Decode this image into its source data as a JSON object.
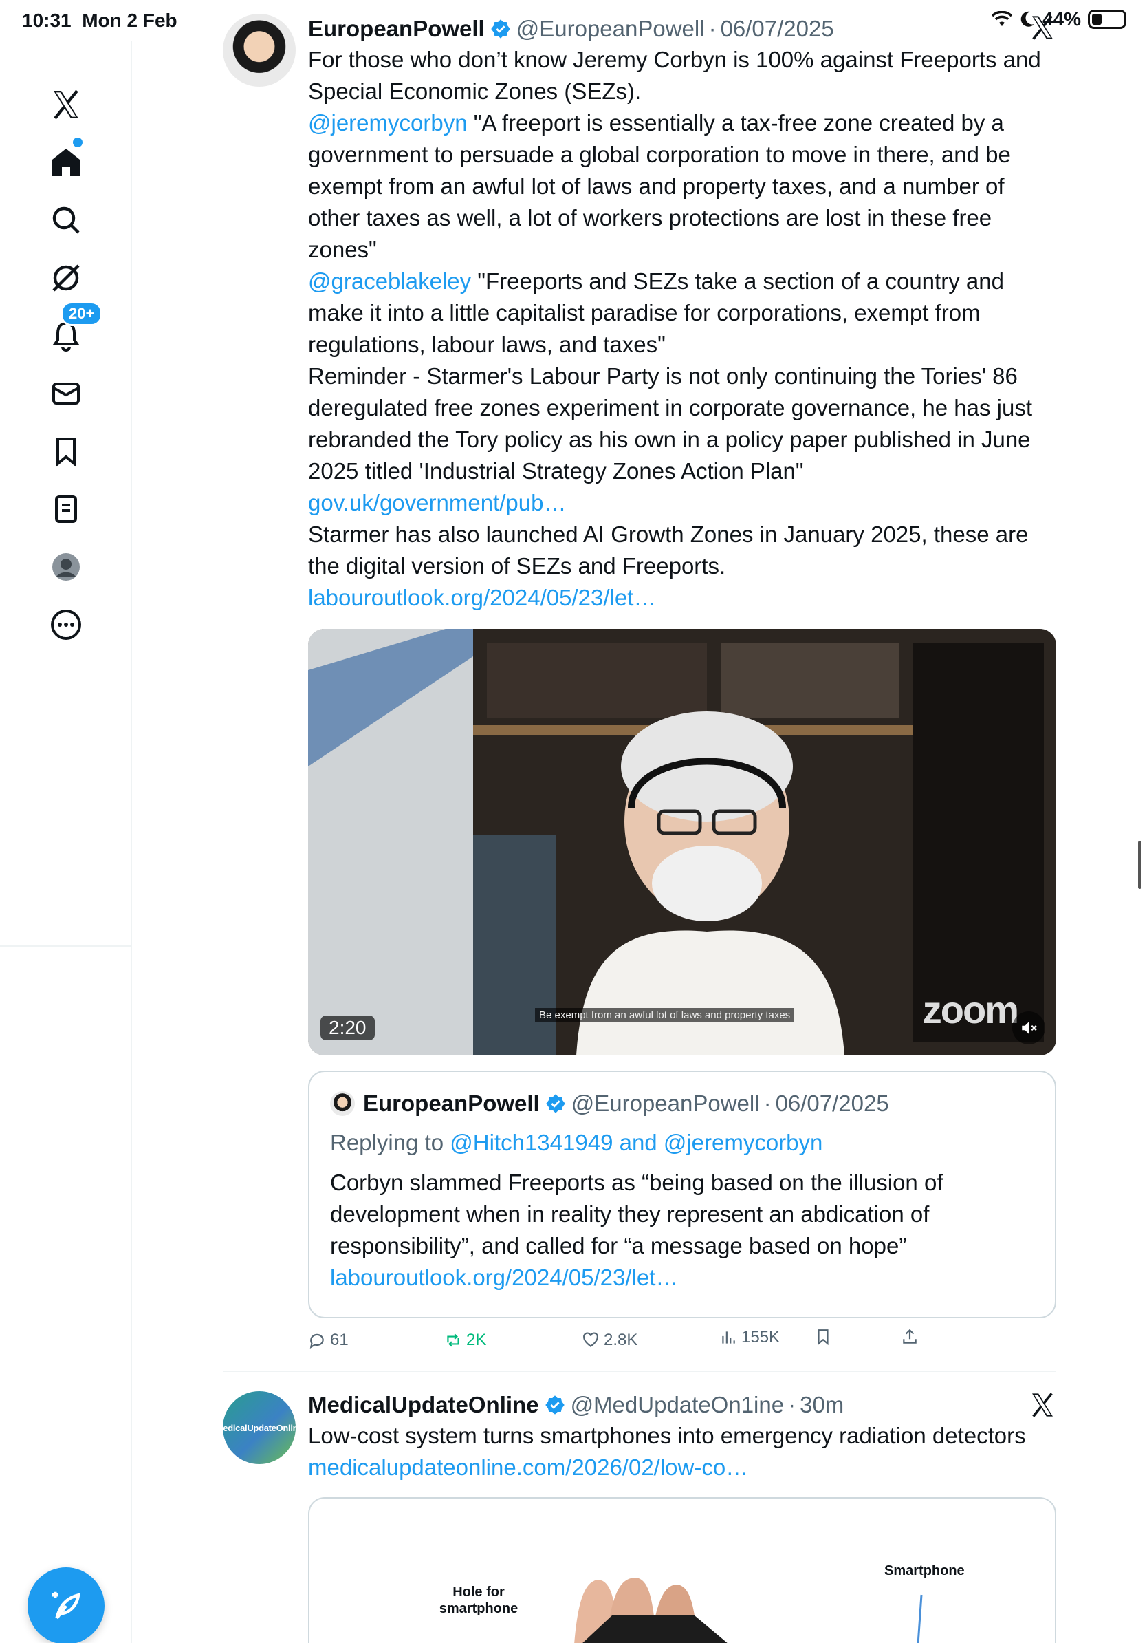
{
  "status_bar": {
    "time": "10:31",
    "date": "Mon 2 Feb",
    "battery": "44%"
  },
  "sidebar": {
    "notifications_badge": "20+",
    "items": [
      "x-logo",
      "home",
      "search",
      "grok",
      "notifications",
      "messages",
      "bookmarks",
      "lists",
      "profile",
      "more"
    ]
  },
  "tweet1": {
    "name": "EuropeanPowell",
    "handle": "@EuropeanPowell",
    "date": "06/07/2025",
    "p1": "For those who don’t know Jeremy Corbyn is 100% against Freeports and Special Economic Zones (SEZs).",
    "mention1": "@jeremycorbyn",
    "p2": " \"A freeport is essentially a tax-free zone created by a government to persuade a global corporation to move in there, and be exempt from an awful lot of laws and property taxes, and a number of other taxes as well, a lot of workers protections are lost in these free zones\"",
    "mention2": "@graceblakeley",
    "p3": " \"Freeports and SEZs take a section of a country and make it into a little capitalist paradise for corporations,  exempt from regulations, labour laws, and taxes\"",
    "p4": "Reminder - Starmer's Labour Party is not only continuing the Tories' 86 deregulated free zones experiment in corporate governance, he has just rebranded the Tory policy as his own in a policy paper published in June 2025 titled 'Industrial Strategy Zones Action Plan\"",
    "link1": "gov.uk/government/pub…",
    "p5": "Starmer has also launched AI Growth Zones in January 2025, these are the digital version of SEZs and Freeports.",
    "link2": "labouroutlook.org/2024/05/23/let…",
    "video": {
      "duration": "2:20",
      "caption": "Be exempt from an awful lot of laws and property taxes",
      "zoom_label": "zoom"
    },
    "quote": {
      "name": "EuropeanPowell",
      "handle": "@EuropeanPowell",
      "date": "06/07/2025",
      "replying_prefix": "Replying to ",
      "replying_to": "@Hitch1341949 and @jeremycorbyn",
      "text": "Corbyn slammed Freeports as “being based on the illusion of development when in reality they represent an abdication of responsibility”, and called for “a message based on hope”",
      "link": "labouroutlook.org/2024/05/23/let…"
    },
    "stats": {
      "replies": "61",
      "reposts": "2K",
      "likes": "2.8K",
      "views": "155K"
    }
  },
  "tweet2": {
    "name": "MedicalUpdateOnline",
    "handle": "@MedUpdateOn1ine",
    "time": "30m",
    "text": "Low-cost system turns smartphones into emergency radiation detectors ",
    "link": "medicalupdateonline.com/2026/02/low-co…",
    "avatar_text": "MedicalUpdateOnline",
    "image_labels": {
      "left": "Hole for smartphone",
      "right": "Smartphone"
    }
  },
  "colors": {
    "accent": "#1d9bf0",
    "repost": "#00ba7c",
    "muted": "#536471"
  }
}
